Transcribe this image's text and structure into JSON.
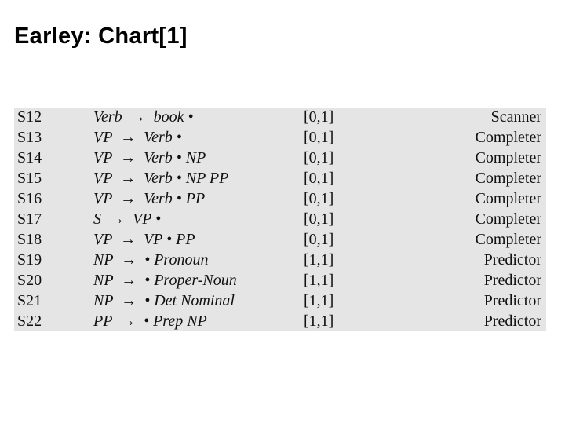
{
  "title": "Earley: Chart[1]",
  "rows": [
    {
      "state": "S12",
      "rule": "Verb  →  book •",
      "span": "[0,1]",
      "op": "Scanner"
    },
    {
      "state": "S13",
      "rule": "VP  →  Verb •",
      "span": "[0,1]",
      "op": "Completer"
    },
    {
      "state": "S14",
      "rule": "VP  →  Verb • NP",
      "span": "[0,1]",
      "op": "Completer"
    },
    {
      "state": "S15",
      "rule": "VP  →  Verb • NP PP",
      "span": "[0,1]",
      "op": "Completer"
    },
    {
      "state": "S16",
      "rule": "VP  →  Verb • PP",
      "span": "[0,1]",
      "op": "Completer"
    },
    {
      "state": "S17",
      "rule": "S  →  VP •",
      "span": "[0,1]",
      "op": "Completer"
    },
    {
      "state": "S18",
      "rule": "VP  →  VP • PP",
      "span": "[0,1]",
      "op": "Completer"
    },
    {
      "state": "S19",
      "rule": "NP  →  • Pronoun",
      "span": "[1,1]",
      "op": "Predictor"
    },
    {
      "state": "S20",
      "rule": "NP  →  • Proper-Noun",
      "span": "[1,1]",
      "op": "Predictor"
    },
    {
      "state": "S21",
      "rule": "NP  →  • Det Nominal",
      "span": "[1,1]",
      "op": "Predictor"
    },
    {
      "state": "S22",
      "rule": "PP  →  • Prep NP",
      "span": "[1,1]",
      "op": "Predictor"
    }
  ]
}
